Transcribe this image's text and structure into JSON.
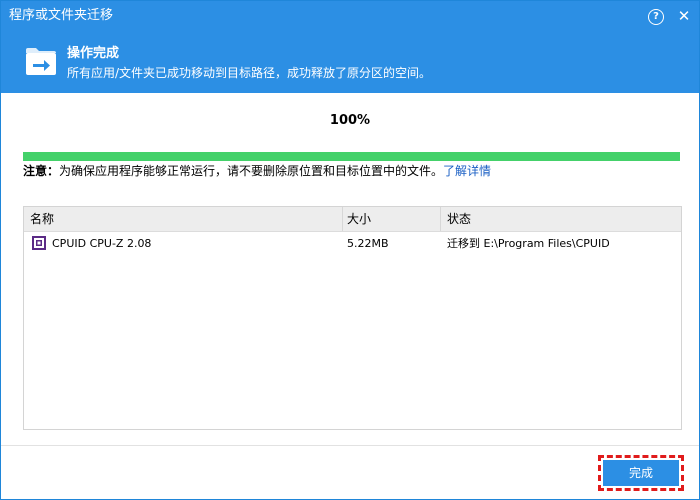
{
  "window": {
    "title": "程序或文件夹迁移",
    "help_icon": "question-circle-icon",
    "close_icon": "close-icon",
    "accent_color": "#2c8fe4"
  },
  "banner": {
    "icon": "folder-arrow-icon",
    "title": "操作完成",
    "subtitle": "所有应用/文件夹已成功移动到目标路径，成功释放了原分区的空间。"
  },
  "progress": {
    "label": "100%",
    "value": 1.0,
    "color": "#44d16a"
  },
  "notice": {
    "prefix": "注意：",
    "text": "为确保应用程序能够正常运行，请不要删除原位置和目标位置中的文件。",
    "link": "了解详情"
  },
  "table": {
    "headers": [
      "名称",
      "大小",
      "状态"
    ],
    "rows": [
      {
        "name": "CPUID CPU-Z 2.08",
        "size": "5.22MB",
        "status": "迁移到 E:\\Program Files\\CPUID",
        "icon": "cpu-z-icon"
      }
    ]
  },
  "footer": {
    "done_label": "完成"
  }
}
